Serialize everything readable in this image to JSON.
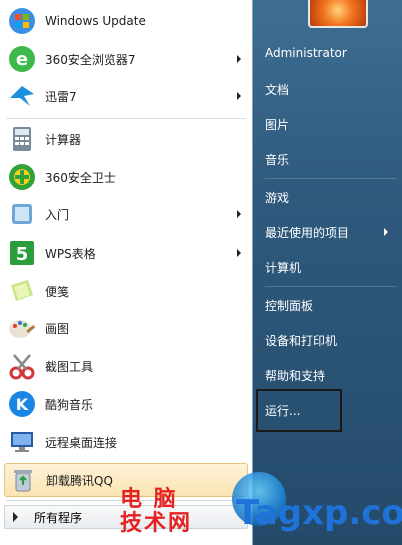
{
  "start_menu": {
    "pinned": [
      {
        "label": "Windows Update",
        "icon": "windows-update-icon"
      },
      {
        "label": "360安全浏览器7",
        "icon": "browser-360-icon",
        "submenu": true
      },
      {
        "label": "迅雷7",
        "icon": "xunlei-icon",
        "submenu": true
      }
    ],
    "recent": [
      {
        "label": "计算器",
        "icon": "calculator-icon"
      },
      {
        "label": "360安全卫士",
        "icon": "security-360-icon"
      },
      {
        "label": "入门",
        "icon": "getting-started-icon",
        "submenu": true
      },
      {
        "label": "WPS表格",
        "icon": "wps-spreadsheet-icon",
        "submenu": true
      },
      {
        "label": "便笺",
        "icon": "sticky-notes-icon"
      },
      {
        "label": "画图",
        "icon": "paint-icon"
      },
      {
        "label": "截图工具",
        "icon": "snipping-tool-icon"
      },
      {
        "label": "酷狗音乐",
        "icon": "kugou-icon"
      },
      {
        "label": "远程桌面连接",
        "icon": "remote-desktop-icon"
      },
      {
        "label": "卸载腾讯QQ",
        "icon": "recycle-bin-icon",
        "highlighted": true
      }
    ],
    "all_programs": "所有程序",
    "right_pane": {
      "user": "Administrator",
      "items": [
        "文档",
        "图片",
        "音乐",
        "游戏",
        "最近使用的项目",
        "计算机",
        "控制面板",
        "设备和打印机",
        "帮助和支持",
        "运行..."
      ]
    }
  },
  "watermark": {
    "line1": "电 脑",
    "line2": "技术网",
    "domain": "Tagxp.com"
  },
  "colors": {
    "right_pane": "#2f5a7d",
    "highlight": "#fbe4b2",
    "watermark_red": "#e52222",
    "watermark_blue": "#1f73d8"
  }
}
